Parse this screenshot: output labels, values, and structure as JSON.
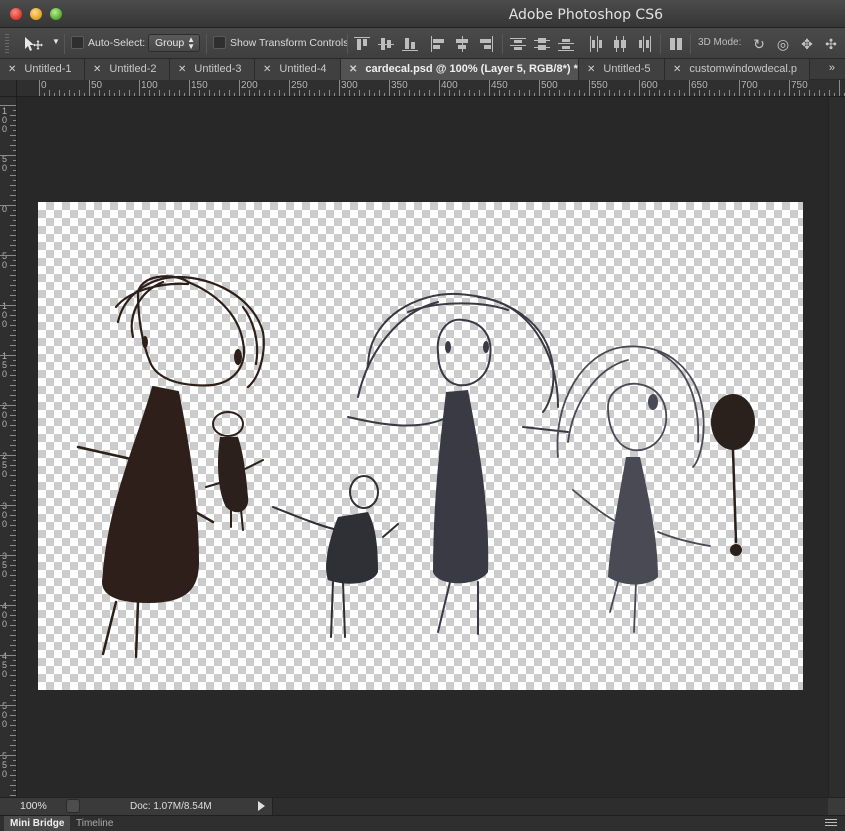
{
  "window": {
    "title": "Adobe Photoshop CS6"
  },
  "options_bar": {
    "tool_icon": "move-tool-icon",
    "auto_select_label": "Auto-Select:",
    "auto_select_target": "Group",
    "show_transform_label": "Show Transform Controls",
    "mode_3d_label": "3D Mode:"
  },
  "tabs": [
    {
      "label": "Untitled-1",
      "active": false
    },
    {
      "label": "Untitled-2",
      "active": false
    },
    {
      "label": "Untitled-3",
      "active": false
    },
    {
      "label": "Untitled-4",
      "active": false
    },
    {
      "label": "cardecal.psd @ 100% (Layer 5, RGB/8*) *",
      "active": true
    },
    {
      "label": "Untitled-5",
      "active": false
    },
    {
      "label": "customwindowdecal.p",
      "active": false
    }
  ],
  "tabs_overflow": "»",
  "ruler_h": [
    "0",
    "50",
    "100",
    "150",
    "200",
    "250",
    "300",
    "350",
    "400",
    "450",
    "500",
    "550",
    "600",
    "650",
    "700",
    "750"
  ],
  "ruler_v": [
    "100",
    "50",
    "0",
    "50",
    "100",
    "150",
    "200",
    "250",
    "300",
    "350",
    "400",
    "450",
    "500",
    "550"
  ],
  "status": {
    "zoom": "100%",
    "doc": "Doc: 1.07M/8.54M"
  },
  "bottom_tabs": [
    {
      "label": "Mini Bridge",
      "active": true
    },
    {
      "label": "Timeline",
      "active": false
    }
  ]
}
